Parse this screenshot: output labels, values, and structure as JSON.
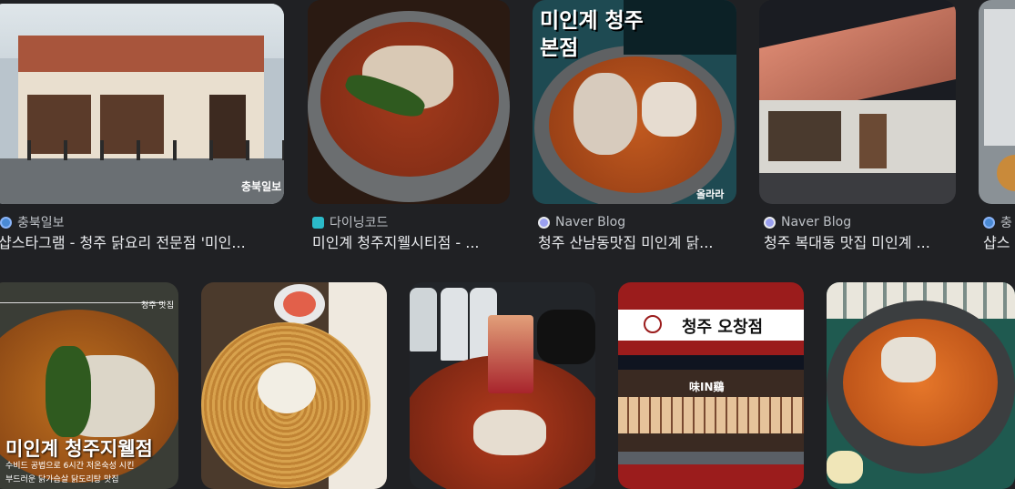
{
  "top_row": [
    {
      "source": "충북일보",
      "title": "샵스타그램 - 청주 닭요리 전문점 '미인...",
      "watermark": "충북일보",
      "favicon": "globe-icon"
    },
    {
      "source": "다이닝코드",
      "title": "미인계 청주지웰시티점 - ...",
      "favicon": "diningcode-icon"
    },
    {
      "source": "Naver Blog",
      "title": "청주 산남동맛집 미인계 닭...",
      "overlay": "미인계 청주 본점",
      "watermark": "올라라",
      "favicon": "naver-icon"
    },
    {
      "source": "Naver Blog",
      "title": "청주 복대동 맛집 미인계 ...",
      "favicon": "naver-icon"
    },
    {
      "source": "충",
      "title": "샵스",
      "favicon": "globe-icon"
    }
  ],
  "bottom_row": [
    {
      "overlay_top": "청주 맛집",
      "overlay_main": "미인계 청주지웰점",
      "overlay_sub1": "수비드 공법으로 6시간 저온숙성 시킨",
      "overlay_sub2": "부드러운 닭가슴살 닭도리탕 맛집"
    },
    {},
    {},
    {
      "banner": "청주 오창점",
      "sign": "味IN鷄"
    },
    {}
  ],
  "colors": {
    "background": "#202124",
    "banner_red": "#9b1c1c"
  }
}
